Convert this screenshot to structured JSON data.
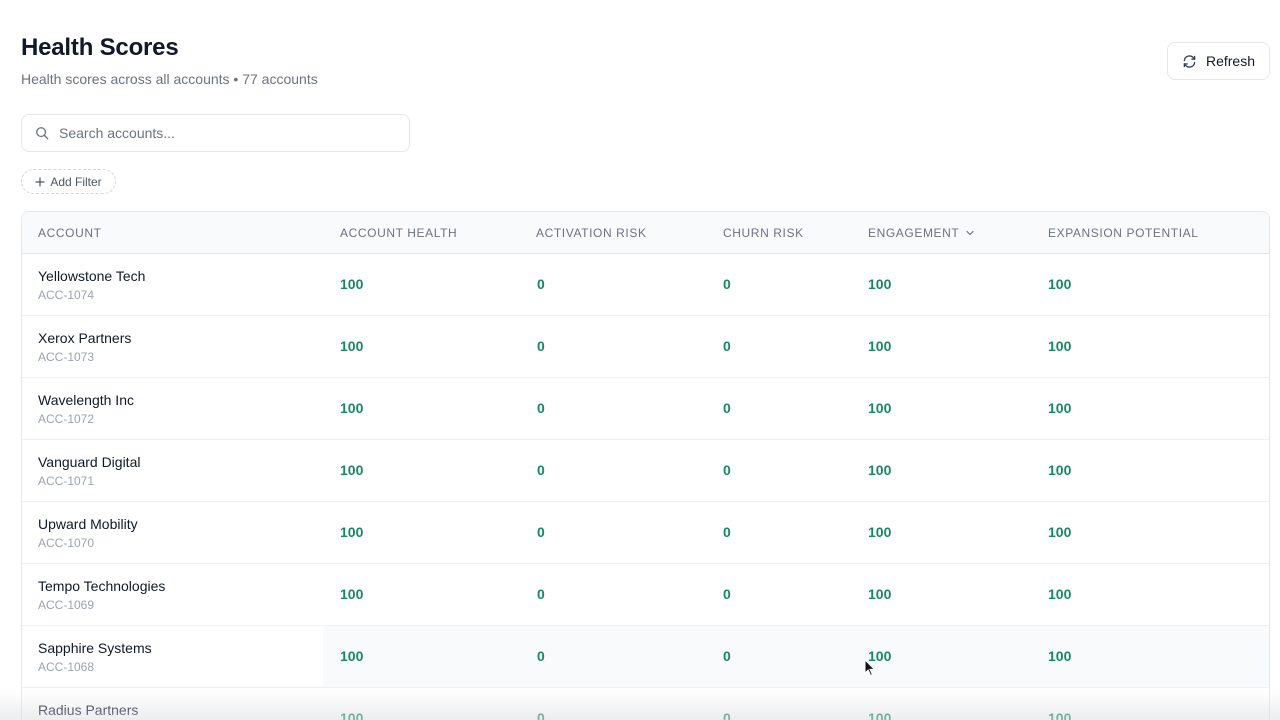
{
  "header": {
    "title": "Health Scores",
    "subtitle": "Health scores across all accounts • 77 accounts",
    "refresh_label": "Refresh"
  },
  "search": {
    "placeholder": "Search accounts..."
  },
  "filters": {
    "add_filter_label": "Add Filter"
  },
  "table": {
    "columns": {
      "account": "ACCOUNT",
      "account_health": "ACCOUNT HEALTH",
      "activation_risk": "ACTIVATION RISK",
      "churn_risk": "CHURN RISK",
      "engagement": "ENGAGEMENT",
      "expansion_potential": "EXPANSION POTENTIAL"
    },
    "sorted_column": "engagement",
    "sort_direction": "descending",
    "rows": [
      {
        "name": "Yellowstone Tech",
        "id": "ACC-1074",
        "account_health": "100",
        "activation_risk": "0",
        "churn_risk": "0",
        "engagement": "100",
        "expansion_potential": "100"
      },
      {
        "name": "Xerox Partners",
        "id": "ACC-1073",
        "account_health": "100",
        "activation_risk": "0",
        "churn_risk": "0",
        "engagement": "100",
        "expansion_potential": "100"
      },
      {
        "name": "Wavelength Inc",
        "id": "ACC-1072",
        "account_health": "100",
        "activation_risk": "0",
        "churn_risk": "0",
        "engagement": "100",
        "expansion_potential": "100"
      },
      {
        "name": "Vanguard Digital",
        "id": "ACC-1071",
        "account_health": "100",
        "activation_risk": "0",
        "churn_risk": "0",
        "engagement": "100",
        "expansion_potential": "100"
      },
      {
        "name": "Upward Mobility",
        "id": "ACC-1070",
        "account_health": "100",
        "activation_risk": "0",
        "churn_risk": "0",
        "engagement": "100",
        "expansion_potential": "100"
      },
      {
        "name": "Tempo Technologies",
        "id": "ACC-1069",
        "account_health": "100",
        "activation_risk": "0",
        "churn_risk": "0",
        "engagement": "100",
        "expansion_potential": "100"
      },
      {
        "name": "Sapphire Systems",
        "id": "ACC-1068",
        "account_health": "100",
        "activation_risk": "0",
        "churn_risk": "0",
        "engagement": "100",
        "expansion_potential": "100"
      },
      {
        "name": "Radius Partners",
        "id": "",
        "account_health": "100",
        "activation_risk": "0",
        "churn_risk": "0",
        "engagement": "100",
        "expansion_potential": "100"
      }
    ]
  },
  "colors": {
    "score_text": "#15895f",
    "header_bg": "#f9fafb",
    "border": "#e5e7eb",
    "muted_text": "#6b7280"
  },
  "icons": {
    "refresh": "refresh-icon",
    "search": "search-icon",
    "add": "plus-icon",
    "sort": "chevron-down-icon"
  }
}
